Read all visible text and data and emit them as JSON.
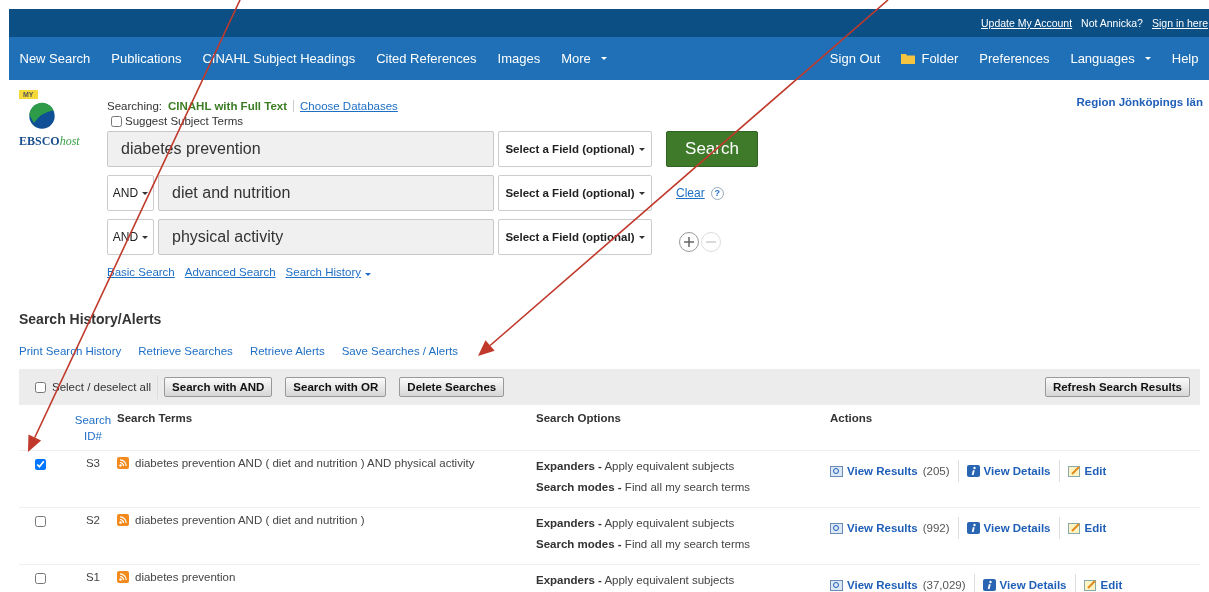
{
  "top_bar": {
    "account_link": "Update My Account",
    "user_prompt": "Not Annicka?",
    "sign_in_link": "Sign in here"
  },
  "nav": {
    "left": [
      {
        "label": "New Search",
        "dropdown": false
      },
      {
        "label": "Publications",
        "dropdown": false
      },
      {
        "label": "CINAHL Subject Headings",
        "dropdown": false
      },
      {
        "label": "Cited References",
        "dropdown": false
      },
      {
        "label": "Images",
        "dropdown": false
      },
      {
        "label": "More",
        "dropdown": true
      }
    ],
    "right": [
      {
        "label": "Sign Out",
        "kind": "link",
        "dropdown": false
      },
      {
        "label": "Folder",
        "kind": "folder",
        "dropdown": false
      },
      {
        "label": "Preferences",
        "kind": "link",
        "dropdown": false
      },
      {
        "label": "Languages",
        "kind": "link",
        "dropdown": true
      },
      {
        "label": "Help",
        "kind": "link",
        "dropdown": false
      }
    ]
  },
  "logo": {
    "badge": "MY",
    "wordmark": "EBSCO",
    "wordmark_suffix": "host"
  },
  "searching": {
    "label": "Searching:",
    "database": "CINAHL with Full Text",
    "link": "Choose Databases"
  },
  "suggest": {
    "label": "Suggest Subject Terms",
    "checked": false
  },
  "institution": "Region Jönköpings län",
  "search_rows": [
    {
      "term": "diabetes prevention",
      "field": "Select a Field (optional)"
    },
    {
      "operator": "AND",
      "term": "diet and nutrition",
      "field": "Select a Field (optional)"
    },
    {
      "operator": "AND",
      "term": "physical activity",
      "field": "Select a Field (optional)"
    }
  ],
  "search_button": "Search",
  "clear_link": "Clear",
  "help_badge": "?",
  "search_links": [
    {
      "label": "Basic Search",
      "dropdown": false
    },
    {
      "label": "Advanced Search",
      "dropdown": false
    },
    {
      "label": "Search History",
      "dropdown": true
    }
  ],
  "history": {
    "title": "Search History/Alerts",
    "links": [
      "Print Search History",
      "Retrieve Searches",
      "Retrieve Alerts",
      "Save Searches / Alerts"
    ],
    "select_all": {
      "label": "Select / deselect all",
      "checked": false
    },
    "buttons": [
      "Search with AND",
      "Search with OR",
      "Delete Searches"
    ],
    "refresh_button": "Refresh Search Results",
    "columns": [
      "Search ID#",
      "Search Terms",
      "Search Options",
      "Actions"
    ],
    "rows": [
      {
        "id": "S3",
        "checked": true,
        "terms": "diabetes prevention AND ( diet and nutrition ) AND physical activity",
        "options": [
          {
            "label": "Expanders -",
            "value": "Apply equivalent subjects"
          },
          {
            "label": "Search modes -",
            "value": "Find all my search terms"
          }
        ],
        "view_results": "View Results",
        "count": "(205)",
        "view_details": "View Details",
        "edit": "Edit"
      },
      {
        "id": "S2",
        "checked": false,
        "terms": "diabetes prevention AND ( diet and nutrition )",
        "options": [
          {
            "label": "Expanders -",
            "value": "Apply equivalent subjects"
          },
          {
            "label": "Search modes -",
            "value": "Find all my search terms"
          }
        ],
        "view_results": "View Results",
        "count": "(992)",
        "view_details": "View Details",
        "edit": "Edit"
      },
      {
        "id": "S1",
        "checked": false,
        "terms": "diabetes prevention",
        "options": [
          {
            "label": "Expanders -",
            "value": "Apply equivalent subjects"
          }
        ],
        "view_results": "View Results",
        "count": "(37,029)",
        "view_details": "View Details",
        "edit": "Edit"
      }
    ]
  }
}
